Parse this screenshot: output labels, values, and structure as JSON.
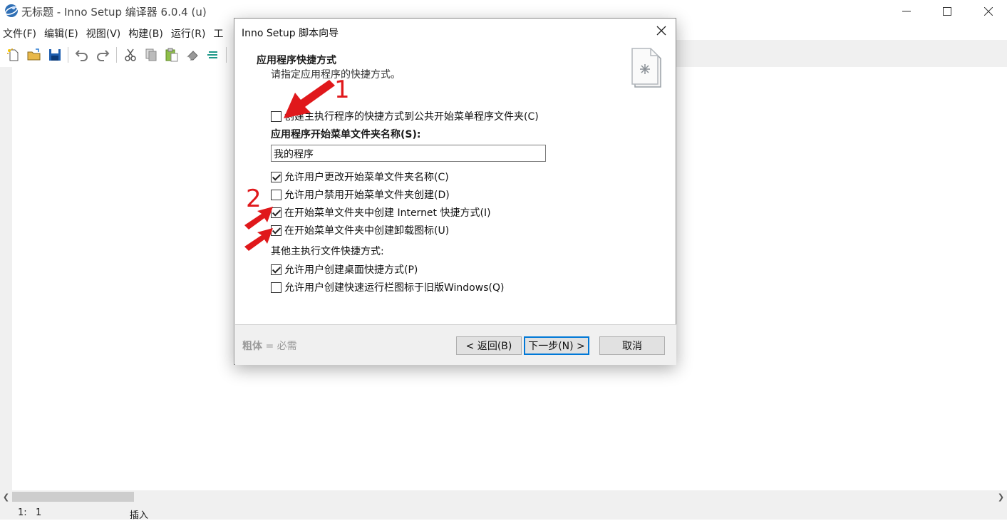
{
  "window": {
    "title": "无标题 - Inno Setup 编译器 6.0.4 (u)"
  },
  "menu": [
    "文件(F)",
    "编辑(E)",
    "视图(V)",
    "构建(B)",
    "运行(R)",
    "工"
  ],
  "toolbar": {
    "icons": [
      "new-file-icon",
      "open-folder-icon",
      "save-icon",
      "undo-icon",
      "redo-icon",
      "cut-icon",
      "copy-icon",
      "paste-icon",
      "eraser-icon",
      "compile-icon"
    ]
  },
  "status": {
    "line": "1:",
    "col": "1",
    "mode": "插入"
  },
  "dialog": {
    "title": "Inno Setup 脚本向导",
    "heading": "应用程序快捷方式",
    "subheading": "请指定应用程序的快捷方式。",
    "create_common_start_menu_label": "创建主执行程序的快捷方式到公共开始菜单程序文件夹(C)",
    "create_common_start_menu_checked": false,
    "folder_name_label": "应用程序开始菜单文件夹名称(S):",
    "folder_name_value": "我的程序",
    "options": [
      {
        "label": "允许用户更改开始菜单文件夹名称(C)",
        "checked": true
      },
      {
        "label": "允许用户禁用开始菜单文件夹创建(D)",
        "checked": false
      },
      {
        "label": "在开始菜单文件夹中创建 Internet 快捷方式(I)",
        "checked": true
      },
      {
        "label": "在开始菜单文件夹中创建卸载图标(U)",
        "checked": true
      }
    ],
    "other_label": "其他主执行文件快捷方式:",
    "other_options": [
      {
        "label": "允许用户创建桌面快捷方式(P)",
        "checked": true
      },
      {
        "label": "允许用户创建快速运行栏图标于旧版Windows(Q)",
        "checked": false
      }
    ],
    "footer_note_bold": "粗体",
    "footer_note_rest": "= 必需",
    "back_label": "< 返回(B)",
    "next_label": "下一步(N) >",
    "cancel_label": "取消"
  },
  "annotations": {
    "marker_1": "1",
    "marker_2": "2",
    "arrow_color": "#e0181b"
  }
}
